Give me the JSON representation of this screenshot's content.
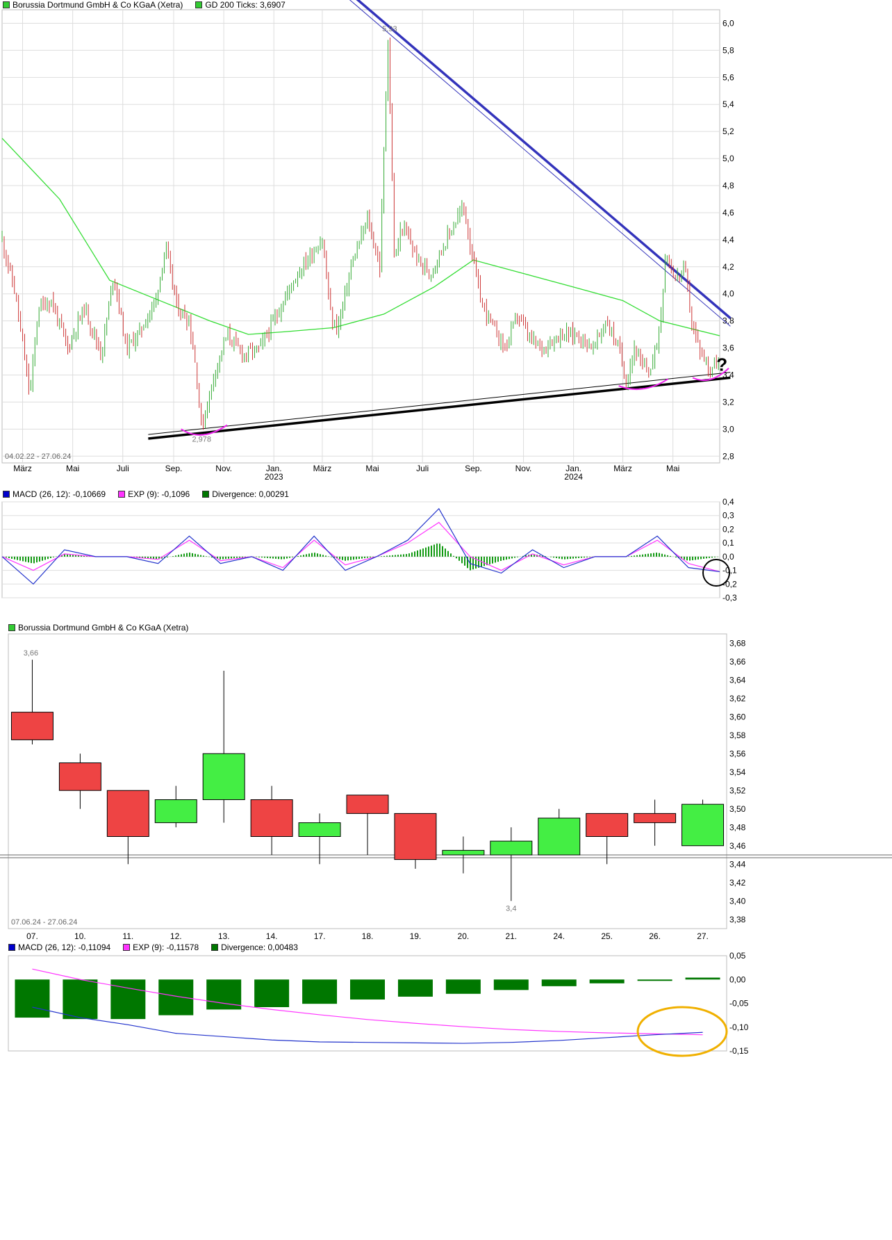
{
  "panels": {
    "p1": {
      "legend": [
        {
          "label": "Borussia Dortmund GmbH & Co KGaA (Xetra)",
          "color": "#33cc33"
        },
        {
          "label": "GD 200 Ticks: 3,6907",
          "color": "#33cc33"
        }
      ],
      "range_label": "04.02.22 - 27.06.24",
      "year_labels": [
        "2023",
        "2024"
      ],
      "high_label": "5,93",
      "low_label": "2,978",
      "question": "?"
    },
    "p2": {
      "legend": [
        {
          "label": "MACD (26, 12): -0,10669",
          "color": "#0000cc"
        },
        {
          "label": "EXP (9): -0,1096",
          "color": "#ff33ff"
        },
        {
          "label": "Divergence: 0,00291",
          "color": "#007700"
        }
      ]
    },
    "p3": {
      "legend": [
        {
          "label": "Borussia Dortmund GmbH & Co KGaA (Xetra)",
          "color": "#33cc33"
        }
      ],
      "range_label": "07.06.24 - 27.06.24",
      "high_label": "3,66",
      "low_label": "3,4"
    },
    "p4": {
      "legend": [
        {
          "label": "MACD (26, 12): -0,11094",
          "color": "#0000cc"
        },
        {
          "label": "EXP (9): -0,11578",
          "color": "#ff33ff"
        },
        {
          "label": "Divergence: 0,00483",
          "color": "#007700"
        }
      ]
    }
  },
  "chart_data": [
    {
      "type": "line",
      "title": "Borussia Dortmund GmbH & Co KGaA (Xetra)",
      "period": "04.02.22 - 27.06.24",
      "yticks": [
        "6,0",
        "5,8",
        "5,6",
        "5,4",
        "5,2",
        "5,0",
        "4,8",
        "4,6",
        "4,4",
        "4,2",
        "4,0",
        "3,8",
        "3,6",
        "3,4",
        "3,2",
        "3,0",
        "2,8"
      ],
      "ytick_values": [
        6.0,
        5.8,
        5.6,
        5.4,
        5.2,
        5.0,
        4.8,
        4.6,
        4.4,
        4.2,
        4.0,
        3.8,
        3.6,
        3.4,
        3.2,
        3.0,
        2.8
      ],
      "ylim": [
        2.75,
        6.1
      ],
      "xticks": [
        "März",
        "Mai",
        "Juli",
        "Sep.",
        "Nov.",
        "Jan.",
        "März",
        "Mai",
        "Juli",
        "Sep.",
        "Nov.",
        "Jan.",
        "März",
        "Mai"
      ],
      "xtick_dates": [
        "2022-03-01",
        "2022-05-01",
        "2022-07-01",
        "2022-09-01",
        "2022-11-01",
        "2023-01-01",
        "2023-03-01",
        "2023-05-01",
        "2023-07-01",
        "2023-09-01",
        "2023-11-01",
        "2024-01-01",
        "2024-03-01",
        "2024-05-01"
      ],
      "xlim": [
        "2022-02-04",
        "2024-06-27"
      ],
      "price": {
        "dates": [
          "2022-02-04",
          "2022-02-20",
          "2022-03-10",
          "2022-03-20",
          "2022-04-05",
          "2022-04-25",
          "2022-05-15",
          "2022-06-05",
          "2022-06-20",
          "2022-07-05",
          "2022-07-20",
          "2022-08-10",
          "2022-08-22",
          "2022-09-05",
          "2022-09-20",
          "2022-09-28",
          "2022-10-05",
          "2022-10-20",
          "2022-11-05",
          "2022-11-25",
          "2022-12-15",
          "2023-01-05",
          "2023-01-25",
          "2023-02-10",
          "2023-03-01",
          "2023-03-12",
          "2023-03-20",
          "2023-04-05",
          "2023-04-25",
          "2023-05-10",
          "2023-05-20",
          "2023-05-28",
          "2023-06-05",
          "2023-06-15",
          "2023-06-25",
          "2023-07-10",
          "2023-07-30",
          "2023-08-20",
          "2023-08-30",
          "2023-09-10",
          "2023-09-25",
          "2023-10-10",
          "2023-10-25",
          "2023-11-10",
          "2023-11-25",
          "2023-12-15",
          "2024-01-05",
          "2024-01-25",
          "2024-02-10",
          "2024-02-25",
          "2024-03-05",
          "2024-03-15",
          "2024-03-25",
          "2024-04-05",
          "2024-04-15",
          "2024-04-22",
          "2024-05-05",
          "2024-05-15",
          "2024-05-25",
          "2024-06-05",
          "2024-06-15",
          "2024-06-27"
        ],
        "values": [
          4.4,
          4.0,
          3.25,
          3.9,
          3.95,
          3.6,
          3.9,
          3.55,
          4.15,
          3.6,
          3.7,
          3.95,
          4.35,
          3.9,
          3.8,
          3.45,
          3.0,
          3.4,
          3.7,
          3.55,
          3.6,
          3.85,
          4.1,
          4.25,
          4.4,
          3.8,
          3.75,
          4.2,
          4.55,
          4.2,
          5.9,
          4.2,
          4.5,
          4.4,
          4.25,
          4.15,
          4.4,
          4.65,
          4.3,
          3.95,
          3.75,
          3.6,
          3.85,
          3.65,
          3.6,
          3.7,
          3.7,
          3.6,
          3.8,
          3.6,
          3.35,
          3.6,
          3.45,
          3.45,
          3.75,
          4.3,
          4.1,
          4.2,
          3.75,
          3.55,
          3.45,
          3.5
        ]
      },
      "gd200": {
        "dates": [
          "2022-02-04",
          "2022-04-15",
          "2022-06-15",
          "2022-08-15",
          "2022-10-15",
          "2022-12-01",
          "2023-01-15",
          "2023-03-15",
          "2023-05-15",
          "2023-07-15",
          "2023-09-01",
          "2023-11-01",
          "2024-01-01",
          "2024-03-01",
          "2024-04-15",
          "2024-06-27"
        ],
        "values": [
          5.15,
          4.7,
          4.1,
          3.95,
          3.8,
          3.7,
          3.72,
          3.75,
          3.85,
          4.05,
          4.25,
          4.15,
          4.05,
          3.95,
          3.8,
          3.69
        ]
      },
      "annotations": [
        "5,93",
        "2,978",
        "?"
      ]
    },
    {
      "type": "line",
      "title": "MACD (26, 12)",
      "yticks": [
        "0,4",
        "0,3",
        "0,2",
        "0,1",
        "0,0",
        "-0,1",
        "-0,2",
        "-0,3"
      ],
      "ytick_values": [
        0.4,
        0.3,
        0.2,
        0.1,
        0.0,
        -0.1,
        -0.2,
        -0.3
      ],
      "ylim": [
        -0.3,
        0.4
      ],
      "series": [
        {
          "name": "MACD (26, 12)",
          "current": -0.10669,
          "values": [
            0.0,
            -0.2,
            0.05,
            0.0,
            0.0,
            -0.05,
            0.15,
            -0.05,
            0.0,
            -0.1,
            0.15,
            -0.1,
            0.0,
            0.12,
            0.35,
            -0.05,
            -0.12,
            0.05,
            -0.08,
            0.0,
            0.0,
            0.15,
            -0.08,
            -0.11
          ]
        },
        {
          "name": "EXP (9)",
          "current": -0.1096,
          "values": [
            0.0,
            -0.1,
            0.02,
            0.0,
            0.0,
            -0.02,
            0.12,
            -0.03,
            0.0,
            -0.08,
            0.12,
            -0.06,
            0.0,
            0.1,
            0.25,
            0.0,
            -0.1,
            0.02,
            -0.06,
            0.0,
            0.0,
            0.12,
            -0.05,
            -0.11
          ]
        },
        {
          "name": "Divergence",
          "current": 0.00291,
          "values": [
            0.0,
            -0.05,
            0.02,
            0.0,
            0.0,
            -0.02,
            0.03,
            -0.02,
            0.0,
            -0.02,
            0.03,
            -0.03,
            0.0,
            0.02,
            0.1,
            -0.1,
            -0.03,
            0.02,
            -0.02,
            0.0,
            0.0,
            0.03,
            -0.03,
            0.0
          ]
        }
      ]
    },
    {
      "type": "candlestick",
      "title": "Borussia Dortmund GmbH & Co KGaA (Xetra)",
      "period": "07.06.24 - 27.06.24",
      "categories": [
        "07.",
        "10.",
        "11.",
        "12.",
        "13.",
        "14.",
        "17.",
        "18.",
        "19.",
        "20.",
        "21.",
        "24.",
        "25.",
        "26.",
        "27."
      ],
      "yticks": [
        "3,68",
        "3,66",
        "3,64",
        "3,62",
        "3,60",
        "3,58",
        "3,56",
        "3,54",
        "3,52",
        "3,50",
        "3,48",
        "3,46",
        "3,44",
        "3,42",
        "3,40",
        "3,38"
      ],
      "ytick_values": [
        3.68,
        3.66,
        3.64,
        3.62,
        3.6,
        3.58,
        3.56,
        3.54,
        3.52,
        3.5,
        3.48,
        3.46,
        3.44,
        3.42,
        3.4,
        3.38
      ],
      "ylim": [
        3.37,
        3.69
      ],
      "open": [
        3.605,
        3.55,
        3.52,
        3.485,
        3.51,
        3.51,
        3.47,
        3.515,
        3.495,
        3.45,
        3.45,
        3.45,
        3.495,
        3.495,
        3.46
      ],
      "close": [
        3.575,
        3.52,
        3.47,
        3.51,
        3.56,
        3.47,
        3.485,
        3.495,
        3.445,
        3.455,
        3.465,
        3.49,
        3.47,
        3.485,
        3.505
      ],
      "high": [
        3.662,
        3.56,
        3.52,
        3.525,
        3.65,
        3.525,
        3.495,
        3.515,
        3.495,
        3.47,
        3.48,
        3.5,
        3.495,
        3.51,
        3.51
      ],
      "low": [
        3.57,
        3.5,
        3.44,
        3.48,
        3.485,
        3.45,
        3.44,
        3.45,
        3.435,
        3.43,
        3.4,
        3.45,
        3.44,
        3.46,
        3.46
      ],
      "reference_line": 3.45,
      "annotations": [
        "3,66",
        "3,4"
      ]
    },
    {
      "type": "bar",
      "title": "MACD (26, 12)",
      "categories": [
        "07.",
        "10.",
        "11.",
        "12.",
        "13.",
        "14.",
        "17.",
        "18.",
        "19.",
        "20.",
        "21.",
        "24.",
        "25.",
        "26.",
        "27."
      ],
      "yticks": [
        "0,05",
        "0,00",
        "-0,05",
        "-0,10",
        "-0,15"
      ],
      "ytick_values": [
        0.05,
        0.0,
        -0.05,
        -0.1,
        -0.15
      ],
      "ylim": [
        -0.15,
        0.05
      ],
      "series": [
        {
          "name": "Divergence",
          "current": 0.00483,
          "values": [
            -0.08,
            -0.083,
            -0.083,
            -0.075,
            -0.063,
            -0.058,
            -0.051,
            -0.042,
            -0.036,
            -0.03,
            -0.022,
            -0.014,
            -0.008,
            -0.002,
            0.004
          ]
        },
        {
          "name": "MACD (26, 12)",
          "current": -0.11094,
          "values": [
            -0.058,
            -0.08,
            -0.095,
            -0.113,
            -0.12,
            -0.127,
            -0.131,
            -0.132,
            -0.133,
            -0.134,
            -0.132,
            -0.128,
            -0.122,
            -0.116,
            -0.111
          ]
        },
        {
          "name": "EXP (9)",
          "current": -0.11578,
          "values": [
            0.022,
            0.0,
            -0.018,
            -0.035,
            -0.05,
            -0.063,
            -0.074,
            -0.084,
            -0.092,
            -0.099,
            -0.105,
            -0.109,
            -0.112,
            -0.114,
            -0.116
          ]
        }
      ]
    }
  ]
}
